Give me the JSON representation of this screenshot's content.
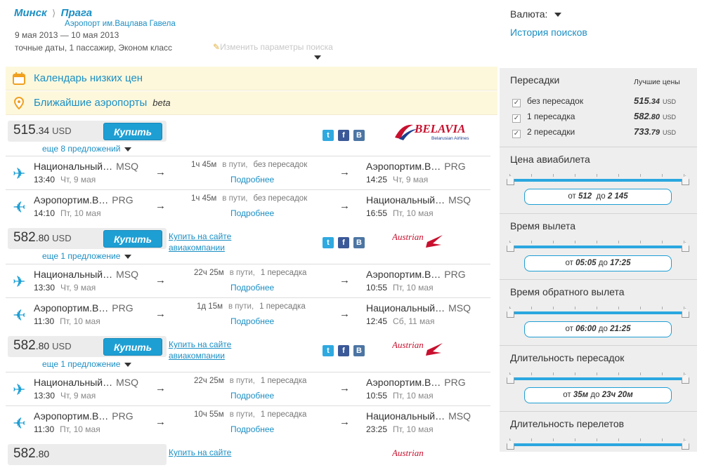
{
  "header": {
    "origin": "Минск",
    "destination": "Прага",
    "dest_airport": "Аэропорт им.Вацлава Гавела",
    "dates": "9 мая 2013  — 10 мая 2013",
    "params": "точные даты,  1 пассажир,  Эконом класс",
    "edit_label": "Изменить параметры поиска",
    "currency_label": "Валюта:",
    "history_label": "История поисков"
  },
  "promos": {
    "calendar": "Календарь низких цен",
    "nearby": "Ближайшие аэропорты",
    "beta": "beta"
  },
  "offers": [
    {
      "price_main": "515",
      "price_frac": ".34",
      "currency": "USD",
      "buy_label": "Купить",
      "more_label": "еще 8 предложений",
      "site_link": "",
      "airline": "BELAVIA",
      "airline_sub": "Belarusian Airlines",
      "segments": [
        {
          "from": "Национальный…",
          "from_code": "MSQ",
          "dep_time": "13:40",
          "dep_date": "Чт, 9 мая",
          "duration": "1ч 45м",
          "in_way": "в пути,",
          "stops": "без пересадок",
          "details": "Подробнее",
          "to": "Аэропортим.В…",
          "to_code": "PRG",
          "arr_time": "14:25",
          "arr_date": "Чт, 9 мая"
        },
        {
          "from": "Аэропортим.В…",
          "from_code": "PRG",
          "dep_time": "14:10",
          "dep_date": "Пт, 10 мая",
          "duration": "1ч 45м",
          "in_way": "в пути,",
          "stops": "без пересадок",
          "details": "Подробнее",
          "to": "Национальный…",
          "to_code": "MSQ",
          "arr_time": "16:55",
          "arr_date": "Пт, 10 мая"
        }
      ]
    },
    {
      "price_main": "582",
      "price_frac": ".80",
      "currency": "USD",
      "buy_label": "Купить",
      "more_label": "еще 1 предложение",
      "site_link_1": "Купить на сайте",
      "site_link_2": "авиакомпании",
      "airline": "Austrian",
      "segments": [
        {
          "from": "Национальный…",
          "from_code": "MSQ",
          "dep_time": "13:30",
          "dep_date": "Чт, 9 мая",
          "duration": "22ч 25м",
          "in_way": "в пути,",
          "stops": "1 пересадка",
          "details": "Подробнее",
          "to": "Аэропортим.В…",
          "to_code": "PRG",
          "arr_time": "10:55",
          "arr_date": "Пт, 10 мая"
        },
        {
          "from": "Аэропортим.В…",
          "from_code": "PRG",
          "dep_time": "11:30",
          "dep_date": "Пт, 10 мая",
          "duration": "1д 15м",
          "in_way": "в пути,",
          "stops": "1 пересадка",
          "details": "Подробнее",
          "to": "Национальный…",
          "to_code": "MSQ",
          "arr_time": "12:45",
          "arr_date": "Сб, 11 мая"
        }
      ]
    },
    {
      "price_main": "582",
      "price_frac": ".80",
      "currency": "USD",
      "buy_label": "Купить",
      "more_label": "еще 1 предложение",
      "site_link_1": "Купить на сайте",
      "site_link_2": "авиакомпании",
      "airline": "Austrian",
      "segments": [
        {
          "from": "Национальный…",
          "from_code": "MSQ",
          "dep_time": "13:30",
          "dep_date": "Чт, 9 мая",
          "duration": "22ч 25м",
          "in_way": "в пути,",
          "stops": "1 пересадка",
          "details": "Подробнее",
          "to": "Аэропортим.В…",
          "to_code": "PRG",
          "arr_time": "10:55",
          "arr_date": "Пт, 10 мая"
        },
        {
          "from": "Аэропортим.В…",
          "from_code": "PRG",
          "dep_time": "11:30",
          "dep_date": "Пт, 10 мая",
          "duration": "10ч 55м",
          "in_way": "в пути,",
          "stops": "1 пересадка",
          "details": "Подробнее",
          "to": "Национальный…",
          "to_code": "MSQ",
          "arr_time": "23:25",
          "arr_date": "Пт, 10 мая"
        }
      ]
    },
    {
      "price_main": "582",
      "price_frac": ".80",
      "site_link_1": "Купить на сайте",
      "airline": "Austrian"
    }
  ],
  "sidebar": {
    "stops_title": "Пересадки",
    "best_prices": "Лучшие цены",
    "stops": [
      {
        "label": "без пересадок",
        "price_main": "515",
        "price_frac": ".34",
        "currency": "USD",
        "checked": true
      },
      {
        "label": "1 пересадка",
        "price_main": "582",
        "price_frac": ".80",
        "currency": "USD",
        "checked": true
      },
      {
        "label": "2 пересадки",
        "price_main": "733",
        "price_frac": ".79",
        "currency": "USD",
        "checked": true
      }
    ],
    "price_title": "Цена авиабилета",
    "price_from": "512",
    "price_to": "2 145",
    "dep_title": "Время вылета",
    "dep_from": "05:05",
    "dep_to": "17:25",
    "ret_title": "Время обратного вылета",
    "ret_from": "06:00",
    "ret_to": "21:25",
    "layover_title": "Длительность пересадок",
    "layover_from": "35м",
    "layover_to": "23ч 20м",
    "flight_title": "Длительность перелетов",
    "from_word": "от",
    "to_word": "до"
  }
}
